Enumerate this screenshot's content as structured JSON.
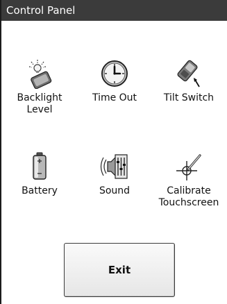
{
  "window": {
    "title": "Control Panel"
  },
  "items": [
    {
      "label": "Backlight\nLevel",
      "icon": "backlight-icon"
    },
    {
      "label": "Time Out",
      "icon": "clock-icon"
    },
    {
      "label": "Tilt Switch",
      "icon": "tilt-switch-icon"
    },
    {
      "label": "Battery",
      "icon": "battery-icon"
    },
    {
      "label": "Sound",
      "icon": "speaker-icon"
    },
    {
      "label": "Calibrate\nTouchscreen",
      "icon": "calibrate-crosshair-icon"
    }
  ],
  "exit_button": {
    "label": "Exit"
  }
}
